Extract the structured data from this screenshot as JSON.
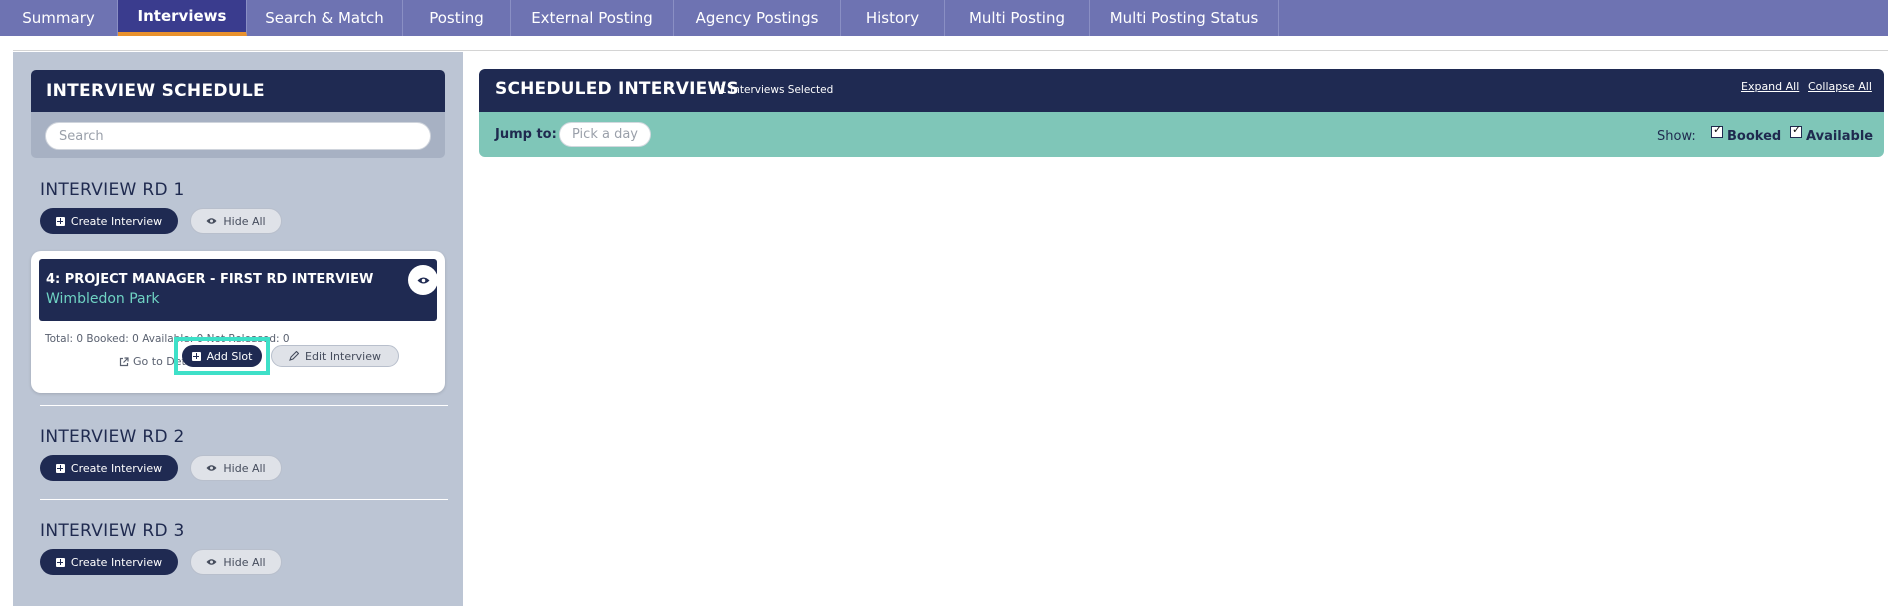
{
  "tabs": [
    {
      "label": "Summary",
      "active": false
    },
    {
      "label": "Interviews",
      "active": true
    },
    {
      "label": "Search & Match",
      "active": false
    },
    {
      "label": "Posting",
      "active": false
    },
    {
      "label": "External Posting",
      "active": false
    },
    {
      "label": "Agency Postings",
      "active": false
    },
    {
      "label": "History",
      "active": false
    },
    {
      "label": "Multi Posting",
      "active": false
    },
    {
      "label": "Multi Posting Status",
      "active": false
    }
  ],
  "schedule": {
    "title": "INTERVIEW SCHEDULE",
    "search_placeholder": "Search"
  },
  "rounds": [
    {
      "title": "INTERVIEW RD 1",
      "create_label": "Create Interview",
      "hide_label": "Hide All"
    },
    {
      "title": "INTERVIEW RD 2",
      "create_label": "Create Interview",
      "hide_label": "Hide All"
    },
    {
      "title": "INTERVIEW RD 3",
      "create_label": "Create Interview",
      "hide_label": "Hide All"
    }
  ],
  "card": {
    "title": "4: PROJECT MANAGER - FIRST RD INTERVIEW",
    "location": "Wimbledon Park",
    "stats": "Total: 0   Booked: 0   Available: 0   Not Released: 0",
    "goto_label": "Go to Details",
    "add_slot_label": "Add Slot",
    "edit_label": "Edit Interview"
  },
  "scheduled": {
    "title": "SCHEDULED INTERVIEWS",
    "selected_text": "- 1 Interviews Selected",
    "expand_all": "Expand All",
    "collapse_all": "Collapse All",
    "jump_label": "Jump to:",
    "pick_placeholder": "Pick a day",
    "show_label": "Show:",
    "booked_label": "Booked",
    "available_label": "Available",
    "booked_checked": true,
    "available_checked": true
  },
  "colors": {
    "tab_bar": "#6e73b2",
    "tab_active": "#3a3c8e",
    "tab_active_underline": "#e8912d",
    "navy": "#1f2a52",
    "left_panel": "#bcc5d4",
    "teal_bar": "#7fc6b8",
    "highlight": "#3ee0c8",
    "location_text": "#6fd3c3"
  }
}
